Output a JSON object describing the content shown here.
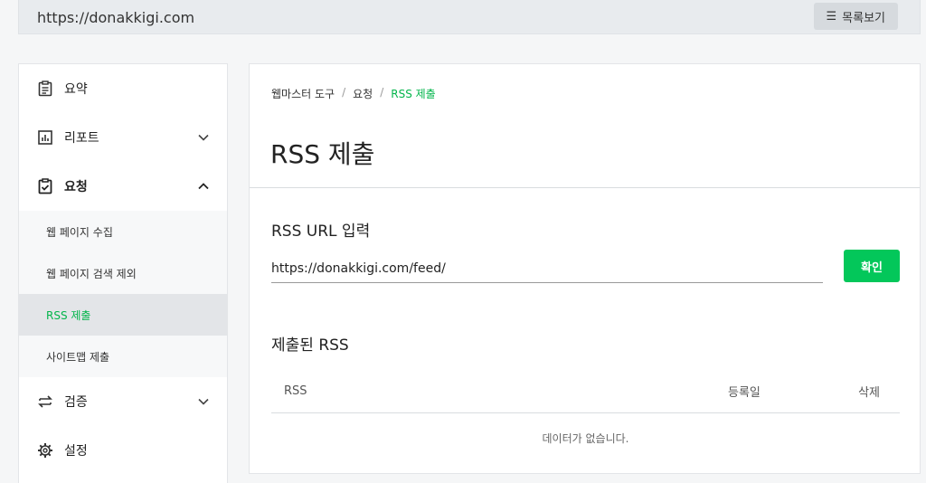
{
  "header": {
    "site_url": "https://donakkigi.com",
    "list_button_label": "목록보기",
    "list_icon": "list-icon"
  },
  "sidebar": {
    "items": [
      {
        "label": "요약",
        "icon": "summary-icon"
      },
      {
        "label": "리포트",
        "icon": "chart-icon",
        "chevron": "chevron-down-icon"
      },
      {
        "label": "요청",
        "icon": "clipboard-check-icon",
        "chevron": "chevron-up-icon"
      },
      {
        "label": "검증",
        "icon": "swap-icon",
        "chevron": "chevron-down-icon"
      },
      {
        "label": "설정",
        "icon": "gear-icon"
      }
    ],
    "sub_items": [
      {
        "label": "웹 페이지 수집"
      },
      {
        "label": "웹 페이지 검색 제외"
      },
      {
        "label": "RSS 제출"
      },
      {
        "label": "사이트맵 제출"
      }
    ]
  },
  "main": {
    "breadcrumb": [
      "웹마스터 도구",
      "요청",
      "RSS 제출"
    ],
    "breadcrumb_separator": "/",
    "title": "RSS 제출",
    "rss_input_label": "RSS URL 입력",
    "rss_input_value": "https://donakkigi.com/feed/",
    "confirm_label": "확인",
    "submitted_label": "제출된 RSS",
    "table_headers": [
      "RSS",
      "등록일",
      "삭제"
    ],
    "empty_text": "데이터가 없습니다."
  },
  "colors": {
    "accent": "#03c75a",
    "active_text": "#03b54b"
  }
}
